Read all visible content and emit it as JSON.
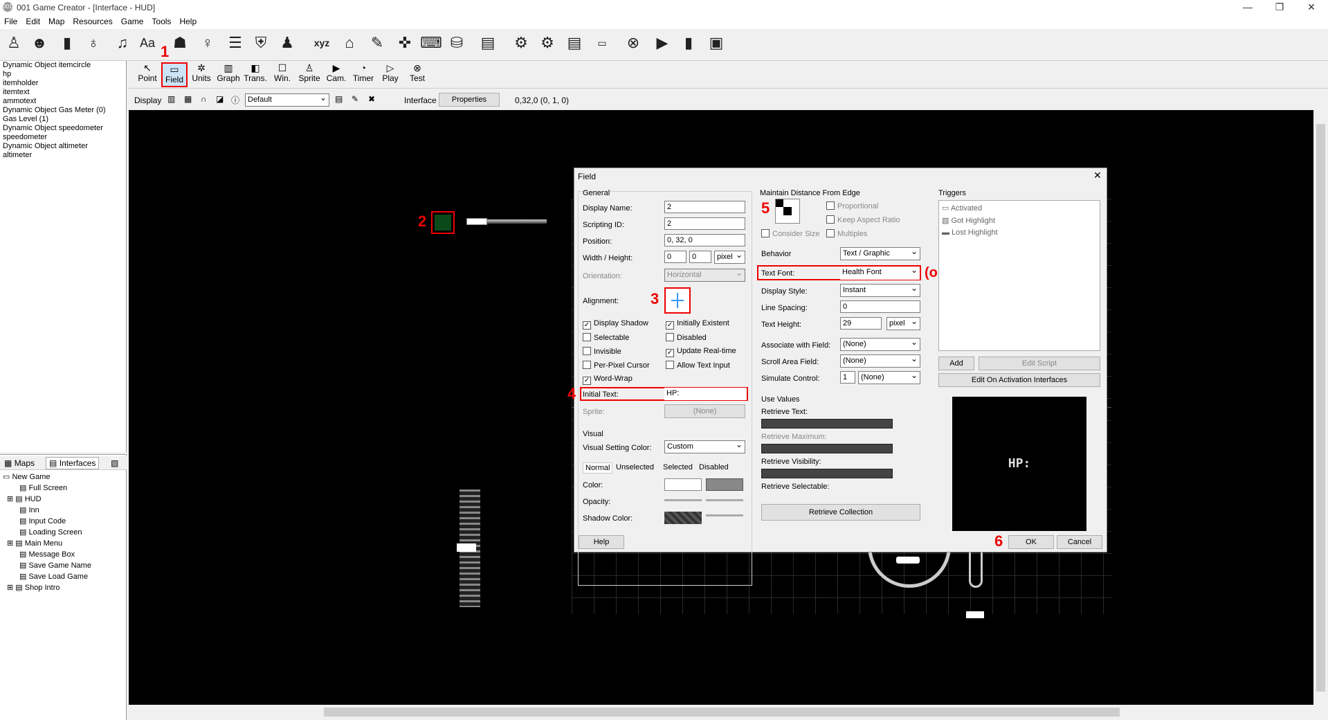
{
  "window": {
    "title": "001 Game Creator - [Interface - HUD]",
    "min": "—",
    "restore": "❐",
    "close": "✕"
  },
  "menu": [
    "File",
    "Edit",
    "Map",
    "Resources",
    "Game",
    "Tools",
    "Help"
  ],
  "object_list": [
    "Dynamic Object itemcircle",
    "hp",
    "itemholder",
    "itemtext",
    "ammotext",
    "Dynamic Object Gas Meter (0)",
    "Gas Level (1)",
    "Dynamic Object speedometer",
    "speedometer",
    "Dynamic Object altimeter",
    "altimeter"
  ],
  "tabs": {
    "maps": "Maps",
    "interfaces": "Interfaces"
  },
  "tree": {
    "root": "New Game",
    "items": [
      "Full Screen",
      "HUD",
      "Inn",
      "Input Code",
      "Loading Screen",
      "Main Menu",
      "Message Box",
      "Save Game Name",
      "Save Load Game",
      "Shop Intro"
    ]
  },
  "tools": [
    "Point",
    "Field",
    "Units",
    "Graph",
    "Trans.",
    "Win.",
    "Sprite",
    "Cam.",
    "Timer",
    "Play",
    "Test"
  ],
  "display": {
    "label": "Display",
    "value": "Default",
    "interface": "Interface",
    "properties": "Properties",
    "coords": "0,32,0 (0, 1, 0)"
  },
  "annotations": {
    "n1": "1",
    "n2": "2",
    "n3": "3",
    "n4": "4",
    "n5": "5",
    "n6": "6",
    "optional": "(optional)"
  },
  "dialog": {
    "title": "Field",
    "general": "General",
    "display_name_lbl": "Display Name:",
    "display_name": "2",
    "scripting_id_lbl": "Scripting ID:",
    "scripting_id": "2",
    "position_lbl": "Position:",
    "position": "0, 32, 0",
    "wh_lbl": "Width / Height:",
    "w": "0",
    "h": "0",
    "unit": "pixel",
    "orientation_lbl": "Orientation:",
    "orientation": "Horizontal",
    "alignment_lbl": "Alignment:",
    "display_shadow": "Display Shadow",
    "initially_existent": "Initially Existent",
    "selectable": "Selectable",
    "disabled": "Disabled",
    "invisible": "Invisible",
    "update_realtime": "Update Real-time",
    "per_pixel": "Per-Pixel Cursor",
    "allow_text": "Allow Text Input",
    "word_wrap": "Word-Wrap",
    "initial_text_lbl": "Initial Text:",
    "initial_text": "HP:",
    "sprite_lbl": "Sprite:",
    "sprite": "(None)",
    "visual": "Visual",
    "visual_color_lbl": "Visual Setting Color:",
    "visual_color": "Custom",
    "vtabs": [
      "Normal",
      "Unselected",
      "Selected",
      "Disabled"
    ],
    "color_lbl": "Color:",
    "opacity_lbl": "Opacity:",
    "shadow_lbl": "Shadow Color:",
    "maintain": "Maintain Distance From Edge",
    "proportional": "Proportional",
    "consider_size": "Consider Size",
    "keep_aspect": "Keep Aspect Ratio",
    "multiples": "Multiples",
    "behavior_lbl": "Behavior",
    "behavior": "Text / Graphic",
    "text_font_lbl": "Text Font:",
    "text_font": "Health Font",
    "display_style_lbl": "Display Style:",
    "display_style": "Instant",
    "line_spacing_lbl": "Line Spacing:",
    "line_spacing": "0",
    "text_height_lbl": "Text Height:",
    "text_height": "29",
    "th_unit": "pixel",
    "assoc_lbl": "Associate with Field:",
    "assoc": "(None)",
    "scroll_lbl": "Scroll Area Field:",
    "scroll": "(None)",
    "sim_lbl": "Simulate Control:",
    "sim_n": "1",
    "sim": "(None)",
    "use_values": "Use Values",
    "retrieve_text": "Retrieve Text:",
    "retrieve_max": "Retrieve Maximum:",
    "retrieve_vis": "Retrieve Visibility:",
    "retrieve_sel": "Retrieve Selectable:",
    "retrieve_collection": "Retrieve Collection",
    "triggers": "Triggers",
    "trig": [
      "Activated",
      "Got Highlight",
      "Lost Highlight"
    ],
    "add": "Add",
    "edit_script": "Edit Script",
    "edit_activation": "Edit On Activation Interfaces",
    "preview": "HP:",
    "help": "Help",
    "ok": "OK",
    "cancel": "Cancel"
  }
}
